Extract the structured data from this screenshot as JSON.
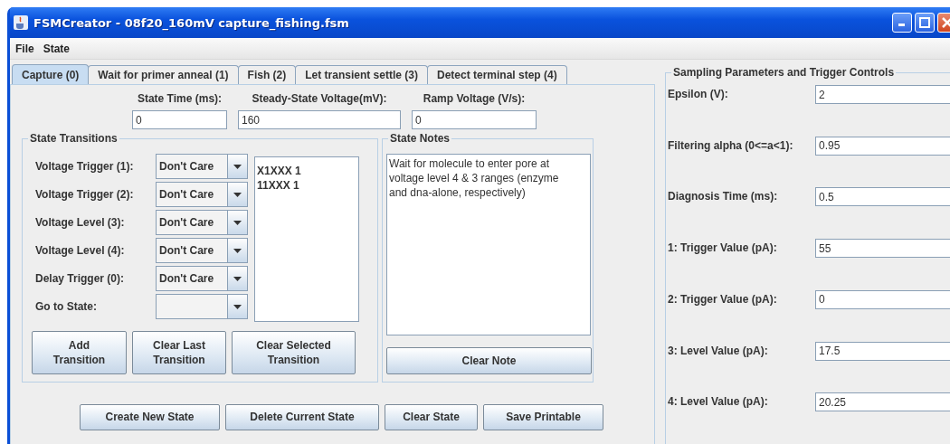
{
  "window": {
    "title": "FSMCreator - 08f20_160mV capture_fishing.fsm"
  },
  "menu": [
    "File",
    "State"
  ],
  "tabs": [
    {
      "label": "Capture (0)",
      "selected": true
    },
    {
      "label": "Wait for primer anneal (1)",
      "selected": false
    },
    {
      "label": "Fish (2)",
      "selected": false
    },
    {
      "label": "Let transient settle (3)",
      "selected": false
    },
    {
      "label": "Detect terminal step (4)",
      "selected": false
    }
  ],
  "state_fields": [
    {
      "label": "State Time (ms):",
      "value": "0"
    },
    {
      "label": "Steady-State Voltage(mV):",
      "value": "160"
    },
    {
      "label": "Ramp Voltage (V/s):",
      "value": "0"
    }
  ],
  "transitions": {
    "title": "State Transitions",
    "rows": [
      {
        "label": "Voltage Trigger (1):",
        "value": "Don't Care"
      },
      {
        "label": "Voltage Trigger (2):",
        "value": "Don't Care"
      },
      {
        "label": "Voltage Level (3):",
        "value": "Don't Care"
      },
      {
        "label": "Voltage Level (4):",
        "value": "Don't Care"
      },
      {
        "label": "Delay Trigger (0):",
        "value": "Don't Care"
      },
      {
        "label": "Go to State:"
      }
    ],
    "list": [
      "X1XXX 1",
      "11XXX 1"
    ],
    "buttons": [
      "Add\nTransition",
      "Clear Last\nTransition",
      "Clear Selected\nTransition"
    ]
  },
  "notes": {
    "title": "State Notes",
    "text": "Wait for molecule to enter pore at voltage level 4 & 3 ranges (enzyme and dna-alone, respectively)",
    "button": "Clear Note"
  },
  "actions": [
    "Create New State",
    "Delete Current State",
    "Clear State",
    "Save Printable"
  ],
  "sampling": {
    "title": "Sampling Parameters and Trigger Controls",
    "params": [
      {
        "label": "Epsilon (V):",
        "value": "2"
      },
      {
        "label": "Filtering alpha (0<=a<1):",
        "value": "0.95"
      },
      {
        "label": "Diagnosis Time (ms):",
        "value": "0.5"
      },
      {
        "label": "1: Trigger Value (pA):",
        "value": "55"
      },
      {
        "label": "2: Trigger Value (pA):",
        "value": "0"
      },
      {
        "label": "3: Level Value (pA):",
        "value": "17.5"
      },
      {
        "label": "4: Level Value (pA):",
        "value": "20.25"
      }
    ]
  }
}
